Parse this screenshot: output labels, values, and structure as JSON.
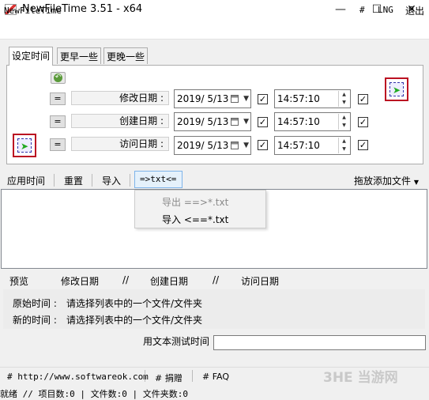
{
  "window": {
    "title": "NewFileTime 3.51 - x64"
  },
  "menu": {
    "app_name": "NewFileTime",
    "hash": "#",
    "lng": "LNG",
    "exit": "退出"
  },
  "tabs": [
    "设定时间",
    "更早一些",
    "更晚一些"
  ],
  "rows": [
    {
      "eq": "=",
      "label": "修改日期 :",
      "date": "2019/  5/13",
      "time": "14:57:10",
      "date_checked": true,
      "time_checked": true
    },
    {
      "eq": "=",
      "label": "创建日期 :",
      "date": "2019/  5/13",
      "time": "14:57:10",
      "date_checked": true,
      "time_checked": true
    },
    {
      "eq": "=",
      "label": "访问日期 :",
      "date": "2019/  5/13",
      "time": "14:57:10",
      "date_checked": true,
      "time_checked": true
    }
  ],
  "toolbar": {
    "apply": "应用时间",
    "reset": "重置",
    "import": "导入",
    "txt": "=>txt<=",
    "drop": "拖放添加文件"
  },
  "dropdown": {
    "export": "导出 ==>*.txt",
    "import": "导入 <==*.txt"
  },
  "preview_header": {
    "preview": "预览",
    "modified": "修改日期",
    "sep1": "//",
    "created": "创建日期",
    "sep2": "//",
    "accessed": "访问日期"
  },
  "info": {
    "original_label": "原始时间 :",
    "original_value": "请选择列表中的一个文件/文件夹",
    "new_label": "新的时间 :",
    "new_value": "请选择列表中的一个文件/文件夹"
  },
  "test": {
    "label": "用文本测试时间",
    "value": ""
  },
  "links": {
    "website": "# http://www.softwareok.com",
    "donate": "# 捐赠",
    "faq": "# FAQ"
  },
  "watermark": {
    "text": "3HE 当游网"
  },
  "status": {
    "text": "就绪 // 项目数:0 | 文件数:0 | 文件夹数:0"
  }
}
